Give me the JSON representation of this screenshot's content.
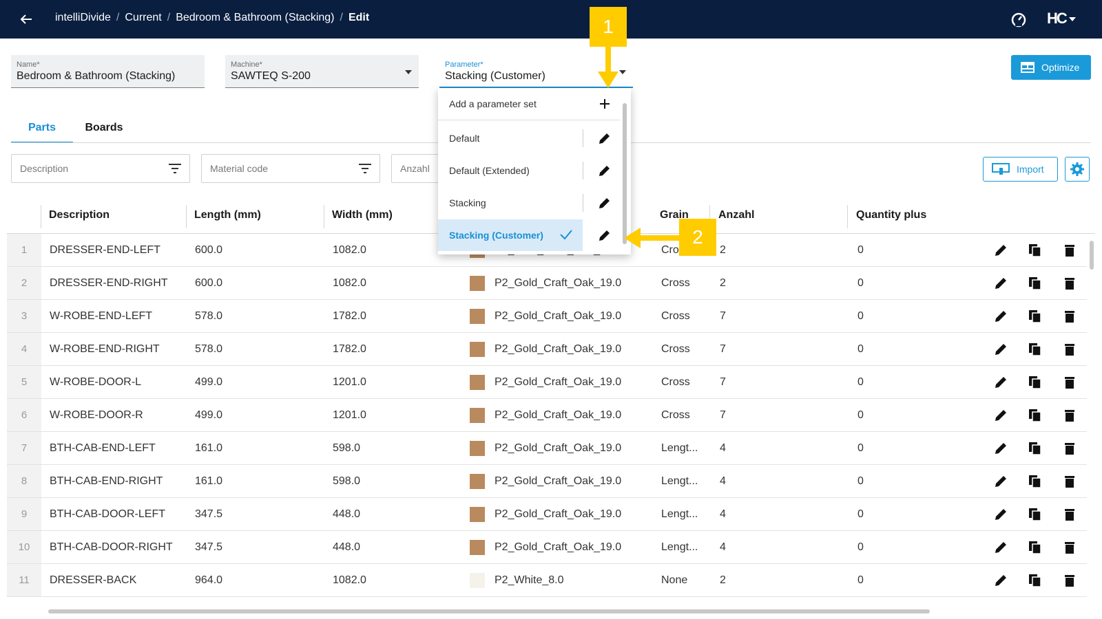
{
  "topbar": {
    "breadcrumb": [
      "intelliDivide",
      "Current",
      "Bedroom & Bathroom (Stacking)",
      "Edit"
    ],
    "logo_text": "HC",
    "icons": [
      "back-arrow-icon",
      "speedometer-icon",
      "user-menu-caret-icon"
    ]
  },
  "form": {
    "name_label": "Name*",
    "name_value": "Bedroom & Bathroom (Stacking)",
    "machine_label": "Machine*",
    "machine_value": "SAWTEQ S-200",
    "parameter_label": "Parameter*",
    "parameter_value": "Stacking (Customer)"
  },
  "toolbar": {
    "optimize_label": "Optimize",
    "import_label": "Import"
  },
  "tabs": [
    "Parts",
    "Boards"
  ],
  "filters": [
    "Description",
    "Material code",
    "Anzahl"
  ],
  "table": {
    "headers": [
      "Description",
      "Length (mm)",
      "Width (mm)",
      "Grain",
      "Anzahl",
      "Quantity plus"
    ],
    "rows": [
      {
        "n": "1",
        "desc": "DRESSER-END-LEFT",
        "len": "600.0",
        "wid": "1082.0",
        "mat": "P2_Gold_Craft_Oak_19.0",
        "grain": "Cro",
        "qty": "2",
        "plus": "0"
      },
      {
        "n": "2",
        "desc": "DRESSER-END-RIGHT",
        "len": "600.0",
        "wid": "1082.0",
        "mat": "P2_Gold_Craft_Oak_19.0",
        "grain": "Cross",
        "qty": "2",
        "plus": "0"
      },
      {
        "n": "3",
        "desc": "W-ROBE-END-LEFT",
        "len": "578.0",
        "wid": "1782.0",
        "mat": "P2_Gold_Craft_Oak_19.0",
        "grain": "Cross",
        "qty": "7",
        "plus": "0"
      },
      {
        "n": "4",
        "desc": "W-ROBE-END-RIGHT",
        "len": "578.0",
        "wid": "1782.0",
        "mat": "P2_Gold_Craft_Oak_19.0",
        "grain": "Cross",
        "qty": "7",
        "plus": "0"
      },
      {
        "n": "5",
        "desc": "W-ROBE-DOOR-L",
        "len": "499.0",
        "wid": "1201.0",
        "mat": "P2_Gold_Craft_Oak_19.0",
        "grain": "Cross",
        "qty": "7",
        "plus": "0"
      },
      {
        "n": "6",
        "desc": "W-ROBE-DOOR-R",
        "len": "499.0",
        "wid": "1201.0",
        "mat": "P2_Gold_Craft_Oak_19.0",
        "grain": "Cross",
        "qty": "7",
        "plus": "0"
      },
      {
        "n": "7",
        "desc": "BTH-CAB-END-LEFT",
        "len": "161.0",
        "wid": "598.0",
        "mat": "P2_Gold_Craft_Oak_19.0",
        "grain": "Lengt...",
        "qty": "4",
        "plus": "0"
      },
      {
        "n": "8",
        "desc": "BTH-CAB-END-RIGHT",
        "len": "161.0",
        "wid": "598.0",
        "mat": "P2_Gold_Craft_Oak_19.0",
        "grain": "Lengt...",
        "qty": "4",
        "plus": "0"
      },
      {
        "n": "9",
        "desc": "BTH-CAB-DOOR-LEFT",
        "len": "347.5",
        "wid": "448.0",
        "mat": "P2_Gold_Craft_Oak_19.0",
        "grain": "Lengt...",
        "qty": "4",
        "plus": "0"
      },
      {
        "n": "10",
        "desc": "BTH-CAB-DOOR-RIGHT",
        "len": "347.5",
        "wid": "448.0",
        "mat": "P2_Gold_Craft_Oak_19.0",
        "grain": "Lengt...",
        "qty": "4",
        "plus": "0"
      },
      {
        "n": "11",
        "desc": "DRESSER-BACK",
        "len": "964.0",
        "wid": "1082.0",
        "mat": "P2_White_8.0",
        "grain": "None",
        "qty": "2",
        "plus": "0"
      }
    ]
  },
  "dropdown": {
    "add_label": "Add a parameter set",
    "items": [
      "Default",
      "Default (Extended)",
      "Stacking",
      "Stacking (Customer)"
    ],
    "selected": "Stacking (Customer)"
  },
  "callouts": [
    "1",
    "2"
  ],
  "colors": {
    "topbar": "#0a1e3f",
    "accent": "#1a9ad9",
    "callout": "#ffcc00",
    "oak": "#b98a5e",
    "white_board": "#f4f2ea"
  }
}
